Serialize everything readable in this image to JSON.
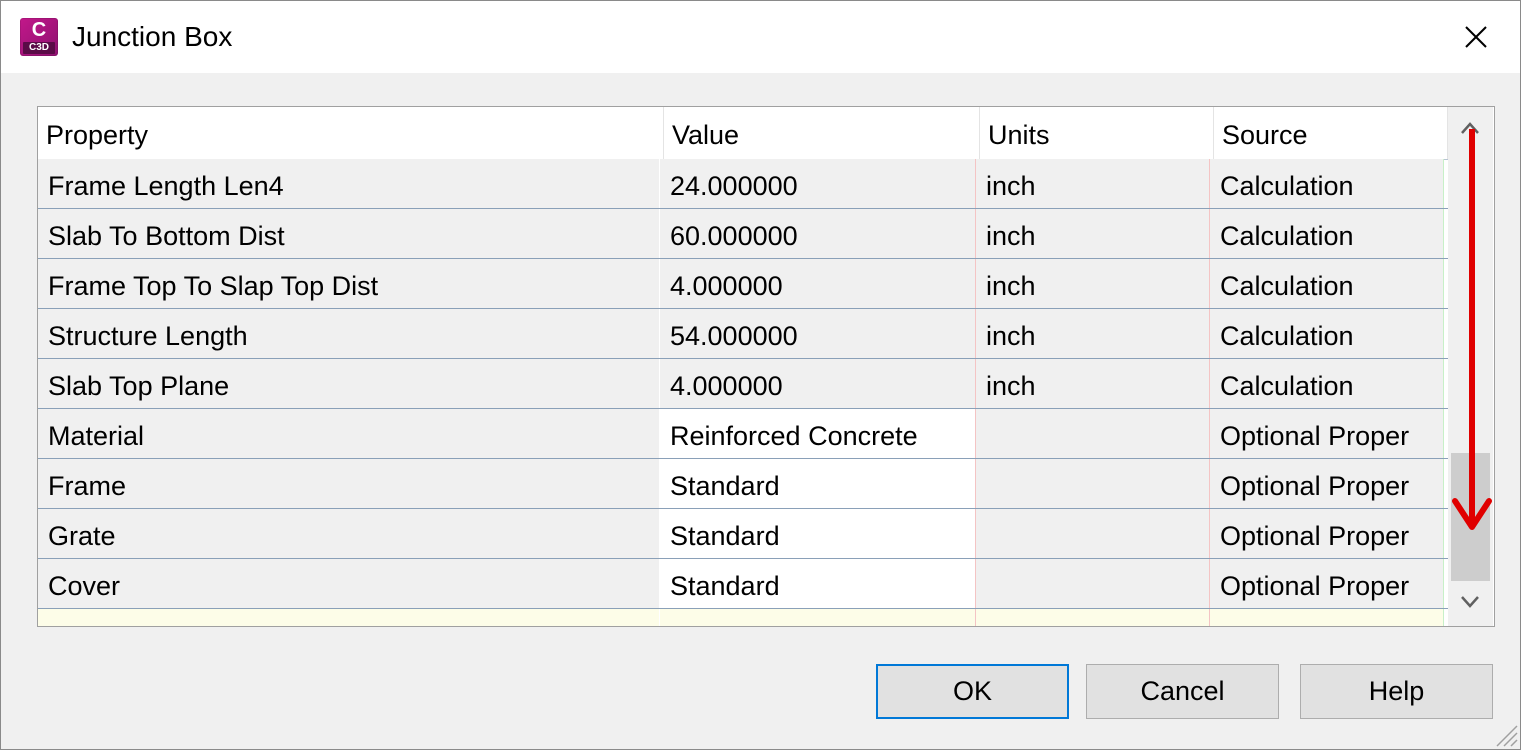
{
  "window": {
    "title": "Junction Box",
    "app_icon": {
      "letter": "C",
      "badge": "C3D",
      "color": "#b0167f"
    }
  },
  "grid": {
    "columns": [
      "Property",
      "Value",
      "Units",
      "Source"
    ],
    "rows": [
      {
        "property": "Frame Length Len4",
        "value": "24.000000",
        "units": "inch",
        "source": "Calculation",
        "editable": false
      },
      {
        "property": "Slab To Bottom Dist",
        "value": "60.000000",
        "units": "inch",
        "source": "Calculation",
        "editable": false
      },
      {
        "property": "Frame Top To Slap Top Dist",
        "value": "4.000000",
        "units": "inch",
        "source": "Calculation",
        "editable": false
      },
      {
        "property": "Structure Length",
        "value": "54.000000",
        "units": "inch",
        "source": "Calculation",
        "editable": false
      },
      {
        "property": "Slab Top Plane",
        "value": "4.000000",
        "units": "inch",
        "source": "Calculation",
        "editable": false
      },
      {
        "property": "Material",
        "value": "Reinforced Concrete",
        "units": "",
        "source": "Optional Proper",
        "editable": true
      },
      {
        "property": "Frame",
        "value": "Standard",
        "units": "",
        "source": "Optional Proper",
        "editable": true
      },
      {
        "property": "Grate",
        "value": "Standard",
        "units": "",
        "source": "Optional Proper",
        "editable": true
      },
      {
        "property": "Cover",
        "value": "Standard",
        "units": "",
        "source": "Optional Proper",
        "editable": true
      }
    ],
    "annotation_color": "#e00000"
  },
  "buttons": {
    "ok": "OK",
    "cancel": "Cancel",
    "help": "Help"
  },
  "colors": {
    "accent_focus": "#0078d7",
    "app_brand": "#b0167f"
  }
}
